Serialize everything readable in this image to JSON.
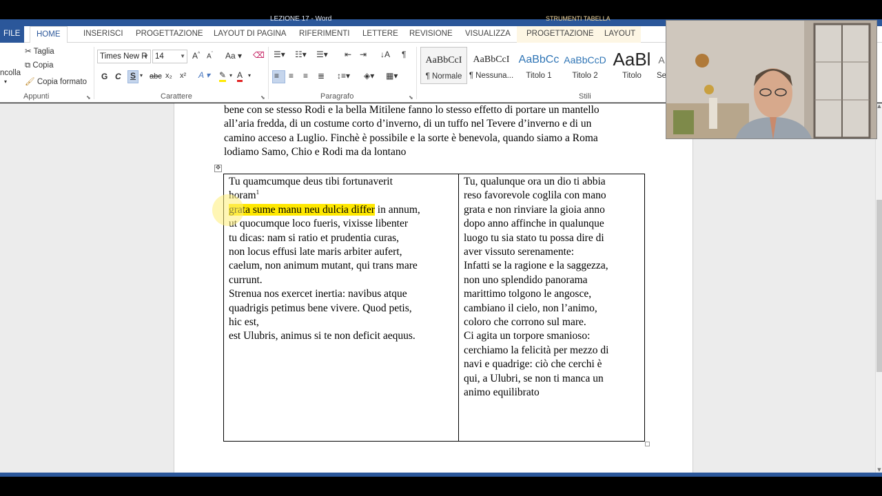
{
  "window": {
    "title": "LEZIONE 17 - Word",
    "context_title": "STRUMENTI TABELLA"
  },
  "tabs": {
    "file": "FILE",
    "items": [
      "HOME",
      "INSERISCI",
      "PROGETTAZIONE",
      "LAYOUT DI PAGINA",
      "RIFERIMENTI",
      "LETTERE",
      "REVISIONE",
      "VISUALIZZA"
    ],
    "context_items": [
      "PROGETTAZIONE",
      "LAYOUT"
    ],
    "active": "HOME"
  },
  "ribbon": {
    "clipboard": {
      "paste_partial": "ncolla",
      "cut": "Taglia",
      "copy": "Copia",
      "format_painter": "Copia formato",
      "group_label": "Appunti"
    },
    "font": {
      "font_name": "Times New R",
      "font_size": "14",
      "group_label": "Carattere"
    },
    "paragraph": {
      "group_label": "Paragrafo"
    },
    "styles": {
      "group_label": "Stili",
      "items": [
        {
          "preview": "AaBbCcI",
          "name": "¶ Normale"
        },
        {
          "preview": "AaBbCcI",
          "name": "¶ Nessuna..."
        },
        {
          "preview": "AaBbCc",
          "name": "Titolo 1"
        },
        {
          "preview": "AaBbCcD",
          "name": "Titolo 2"
        },
        {
          "preview": "AaBl",
          "name": "Titolo"
        },
        {
          "preview": "A",
          "name": "Se"
        }
      ]
    }
  },
  "document": {
    "paragraph_lines": [
      "bene con se stesso Rodi e la bella Mitilene fanno lo stesso effetto di portare un mantello",
      "all’aria fredda, di un costume corto d’inverno, di un tuffo nel Tevere d’inverno e di un",
      "camino acceso a Luglio. Finchè è possibile e la sorte è benevola, quando siamo a Roma",
      "lodiamo Samo, Chio e Rodi ma da lontano"
    ],
    "latin": {
      "line1": "Tu quamcumque deus tibi fortunaverit",
      "line2": "horam",
      "footnote": "1",
      "line3_hl": "grata sume manu neu dulcia differ",
      "line3_rest": " in annum,",
      "lines": [
        "ut quocumque loco fueris, vixisse libenter",
        "tu dicas: nam si ratio et prudentia curas,",
        "non locus effusi late maris arbiter aufert,",
        "caelum, non animum mutant, qui trans mare",
        "currunt.",
        "Strenua nos exercet inertia: navibus atque",
        "quadrigis petimus bene vivere. Quod petis,",
        "hic est,",
        "est Ulubris, animus si te non deficit aequus."
      ]
    },
    "italian": {
      "lines": [
        "Tu, qualunque ora un dio ti abbia",
        "reso favorevole coglila con mano",
        "grata e non rinviare la gioia anno",
        "dopo anno affinche in qualunque",
        "luogo tu sia stato tu possa dire di",
        "aver vissuto serenamente:",
        "Infatti se la ragione e la saggezza,",
        "non uno splendido panorama",
        "marittimo tolgono le angosce,",
        "cambiano il cielo, non l’animo,",
        "coloro che corrono sul mare.",
        "Ci agita un torpore smanioso:",
        "cerchiamo la felicità per mezzo di",
        "navi e quadrige: ciò che cerchi è",
        "qui, a Ulubri, se non ti manca un",
        "animo equilibrato"
      ]
    }
  },
  "colors": {
    "brand": "#2b579a",
    "highlight": "#ffe800"
  }
}
